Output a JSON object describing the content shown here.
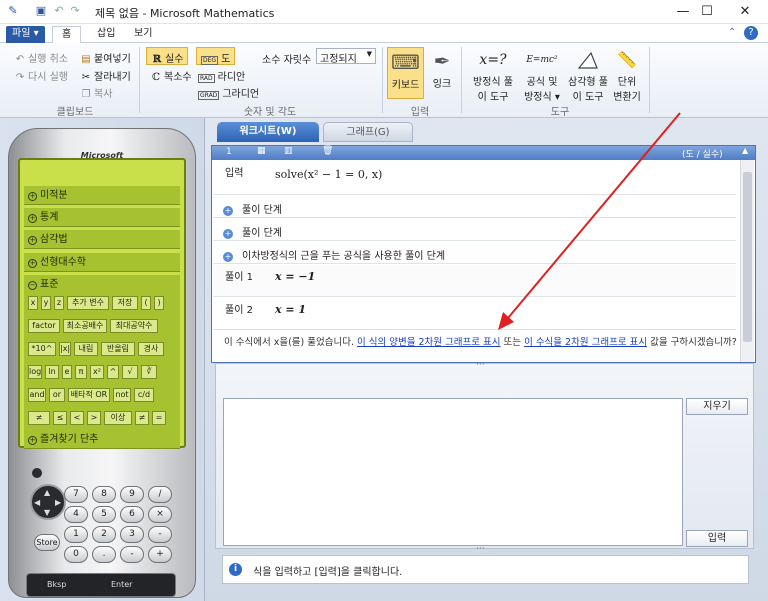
{
  "window": {
    "title": "제목 없음 - Microsoft Mathematics",
    "minimize_glyph": "—",
    "maximize_glyph": "☐",
    "close_glyph": "✕"
  },
  "ribbon_tabs": [
    "파일",
    "홈",
    "삽입",
    "보기"
  ],
  "ribbon": {
    "clipboard": {
      "undo": "실행 취소",
      "redo": "다시 실행",
      "paste": "붙여넣기",
      "cut": "잘라내기",
      "copy": "복사",
      "group": "클립보드"
    },
    "numbers": {
      "real": "실수",
      "complex": "복소수",
      "deg": "도",
      "rad": "라디안",
      "grad": "그라디언",
      "deg_abbr": "DEG",
      "rad_abbr": "RAD",
      "grad_abbr": "GRAD",
      "precision_label": "소수 자릿수",
      "precision_value": "고정되지",
      "group": "숫자 및 각도"
    },
    "input": {
      "keyboard": "키보드",
      "ink": "잉크",
      "group": "입력"
    },
    "tools": {
      "equation_solver_1": "방정식 풀",
      "equation_solver_2": "이 도구",
      "formulas_1": "공식 및",
      "formulas_2": "방정식",
      "triangle_1": "삼각형 풀",
      "triangle_2": "이 도구",
      "unit_1": "단위",
      "unit_2": "변환기",
      "group": "도구",
      "eq_icon_text": "x=?",
      "formula_icon_text": "E=mc²"
    }
  },
  "calculator": {
    "brand": "Microsoft",
    "categories_top": [
      "미적분",
      "통계",
      "삼각법",
      "선형대수학"
    ],
    "standard_label": "표준",
    "key_rows": [
      [
        "x",
        "y",
        "z",
        "추가 변수",
        "저장",
        "(",
        ")"
      ],
      [
        "factor",
        "최소공배수",
        "최대공약수"
      ],
      [
        "*10^",
        "|x|",
        "내림",
        "반올림",
        "경사"
      ],
      [
        "log",
        "ln",
        "e",
        "π",
        "x²",
        "^",
        "√",
        "∛"
      ],
      [
        "and",
        "or",
        "배타적 OR",
        "not",
        "c/d"
      ],
      [
        "≠",
        "≤",
        "<",
        ">",
        "이상",
        "≠",
        "="
      ]
    ],
    "favorites_label": "즐겨찾기 단추",
    "keypad": [
      [
        "7",
        "8",
        "9",
        "/"
      ],
      [
        "4",
        "5",
        "6",
        "×"
      ],
      [
        "1",
        "2",
        "3",
        "-"
      ],
      [
        "0",
        ".",
        "-",
        "+"
      ]
    ],
    "store_label": "Store",
    "bksp_label": "Bksp",
    "enter_label": "Enter"
  },
  "tabs": {
    "worksheet": "워크시트(W)",
    "graph": "그래프(G)"
  },
  "worksheet": {
    "entry_number": "1",
    "mode": "(도 / 실수)",
    "input_label": "입력",
    "input_expr": "solve(x² − 1 = 0, x)",
    "steps": [
      "풀이 단계",
      "풀이 단계",
      "이차방정식의 근을 푸는 공식을 사용한 풀이 단계"
    ],
    "solutions": [
      {
        "label": "풀이 1",
        "expr": "x = −1"
      },
      {
        "label": "풀이 2",
        "expr": "x = 1"
      }
    ],
    "message_prefix": "이 수식에서 x을(를) 풀었습니다. ",
    "link1": "이 식의 양변을 2차원 그래프로 표시",
    "message_mid": " 또는 ",
    "link2": "이 수식을 2차원 그래프로 표시",
    "message_suffix": " 값을 구하시겠습니까?"
  },
  "input_area": {
    "clear_label": "지우기",
    "enter_label": "입력",
    "status": "식을 입력하고 [입력]을 클릭합니다.",
    "grip": "···"
  }
}
